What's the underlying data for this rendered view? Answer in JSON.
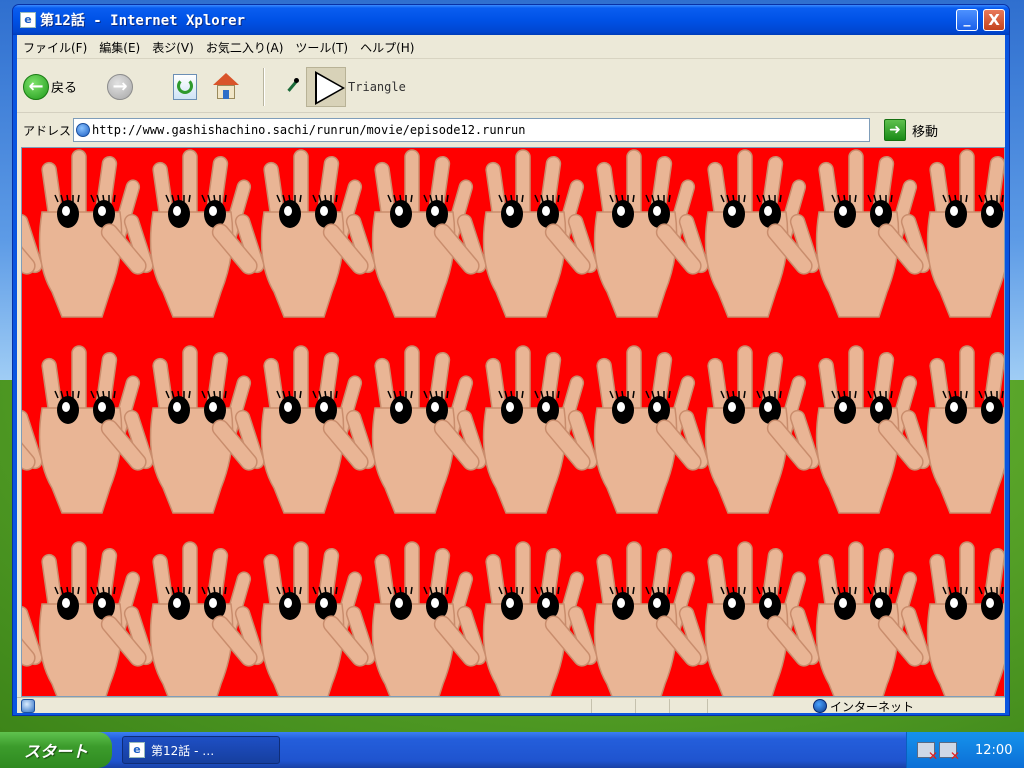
{
  "window": {
    "title": "第12話 - Internet Xplorer",
    "min_label": "_",
    "close_label": "X"
  },
  "menu": {
    "items": [
      {
        "label": "ファイル(F)"
      },
      {
        "label": "編集(E)"
      },
      {
        "label": "表ジ(V)"
      },
      {
        "label": "お気二入り(A)"
      },
      {
        "label": "ツール(T)"
      },
      {
        "label": "ヘルプ(H)"
      }
    ]
  },
  "toolbar": {
    "back_label": "戻る",
    "triangle_label": "Triangle"
  },
  "address": {
    "label": "アドレス",
    "url": "http://www.gashishachino.sachi/runrun/movie/episode12.runrun",
    "go_label": "移動"
  },
  "content": {
    "background_color": "#ff0000",
    "pattern": "repeating hands with eyes",
    "rows": 3,
    "cols": 9
  },
  "status": {
    "zone": "インターネット"
  },
  "taskbar": {
    "start_label": "スタート",
    "task_title": "第12話 - …",
    "clock": "12:00"
  },
  "colors": {
    "content_bg": "#ff0000",
    "skin": "#e9b595",
    "skin_shadow": "#c98d6d"
  }
}
